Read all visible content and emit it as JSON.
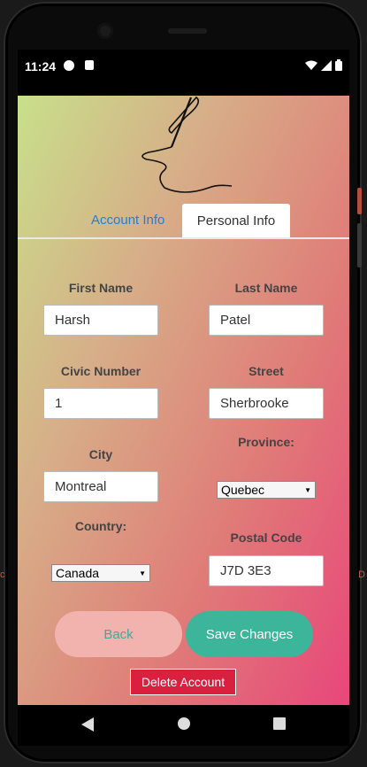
{
  "status_bar": {
    "time": "11:24"
  },
  "tabs": {
    "account": "Account Info",
    "personal": "Personal Info"
  },
  "form": {
    "first_name": {
      "label": "First Name",
      "value": "Harsh"
    },
    "last_name": {
      "label": "Last Name",
      "value": "Patel"
    },
    "civic_number": {
      "label": "Civic Number",
      "value": "1"
    },
    "street": {
      "label": "Street",
      "value": "Sherbrooke"
    },
    "city": {
      "label": "City",
      "value": "Montreal"
    },
    "province": {
      "label": "Province:",
      "value": "Quebec"
    },
    "country": {
      "label": "Country:",
      "value": "Canada"
    },
    "postal_code": {
      "label": "Postal Code",
      "value": "J7D 3E3"
    }
  },
  "actions": {
    "back": "Back",
    "save": "Save Changes",
    "delete": "Delete Account"
  },
  "colors": {
    "gradient_start": "#c8e08a",
    "gradient_end": "#e8467a",
    "tab_active_text": "#1f7fe0",
    "save_button": "#3db59b",
    "back_button": "#f2b2ae",
    "delete_button": "#d9213f"
  },
  "icons": [
    "quill-pen-logo-icon",
    "wifi-icon",
    "signal-icon",
    "battery-icon",
    "nav-back-icon",
    "nav-home-icon",
    "nav-recents-icon"
  ]
}
